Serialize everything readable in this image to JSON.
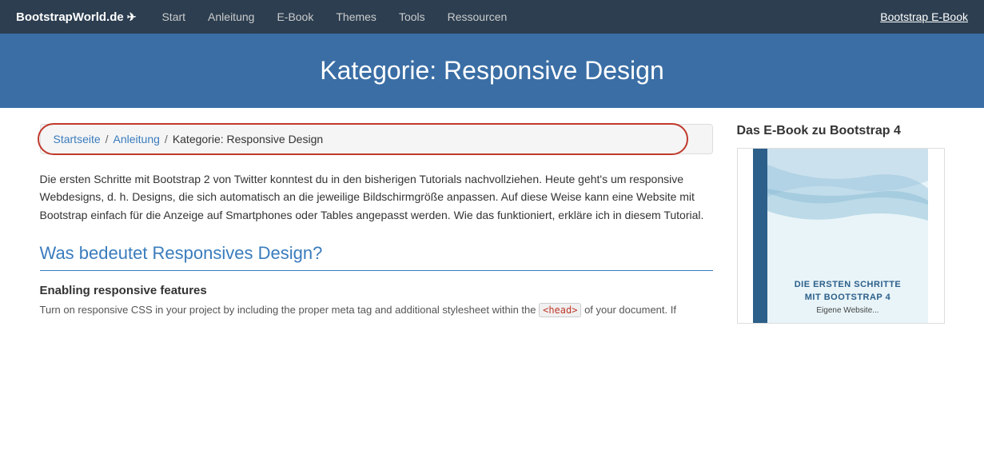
{
  "navbar": {
    "brand": "BootstrapWorld.de",
    "brand_icon": "✈",
    "links": [
      {
        "label": "Start",
        "href": "#"
      },
      {
        "label": "Anleitung",
        "href": "#"
      },
      {
        "label": "E-Book",
        "href": "#"
      },
      {
        "label": "Themes",
        "href": "#"
      },
      {
        "label": "Tools",
        "href": "#"
      },
      {
        "label": "Ressourcen",
        "href": "#"
      }
    ],
    "cta": "Bootstrap E-Book"
  },
  "hero": {
    "title": "Kategorie: Responsive Design"
  },
  "breadcrumb": {
    "items": [
      {
        "label": "Startseite",
        "href": "#"
      },
      {
        "label": "Anleitung",
        "href": "#"
      },
      {
        "label": "Kategorie: Responsive Design",
        "current": true
      }
    ],
    "separator": "/"
  },
  "content": {
    "intro": "Die ersten Schritte mit Bootstrap 2 von Twitter konntest du in den bisherigen Tutorials nachvollziehen. Heute geht's um responsive Webdesigns, d. h. Designs, die sich automatisch an die jeweilige Bildschirmgröße anpassen. Auf diese Weise kann eine Website mit Bootstrap einfach für die Anzeige auf Smartphones oder Tables angepasst werden. Wie das funktioniert, erkläre ich in diesem Tutorial.",
    "section_title": "Was bedeutet Responsives Design?",
    "subsection_title": "Enabling responsive features",
    "subsection_text": "Turn on responsive CSS in your project by including the proper meta tag and additional stylesheet within the ",
    "subsection_code": "<head>",
    "subsection_text2": " of your document. If"
  },
  "sidebar": {
    "title": "Das E-Book zu Bootstrap 4",
    "ebook_title_line1": "DIE ERSTEN SCHRITTE",
    "ebook_title_line2": "MIT BOOTSTRAP 4",
    "ebook_subtitle": "Eigene Website..."
  }
}
